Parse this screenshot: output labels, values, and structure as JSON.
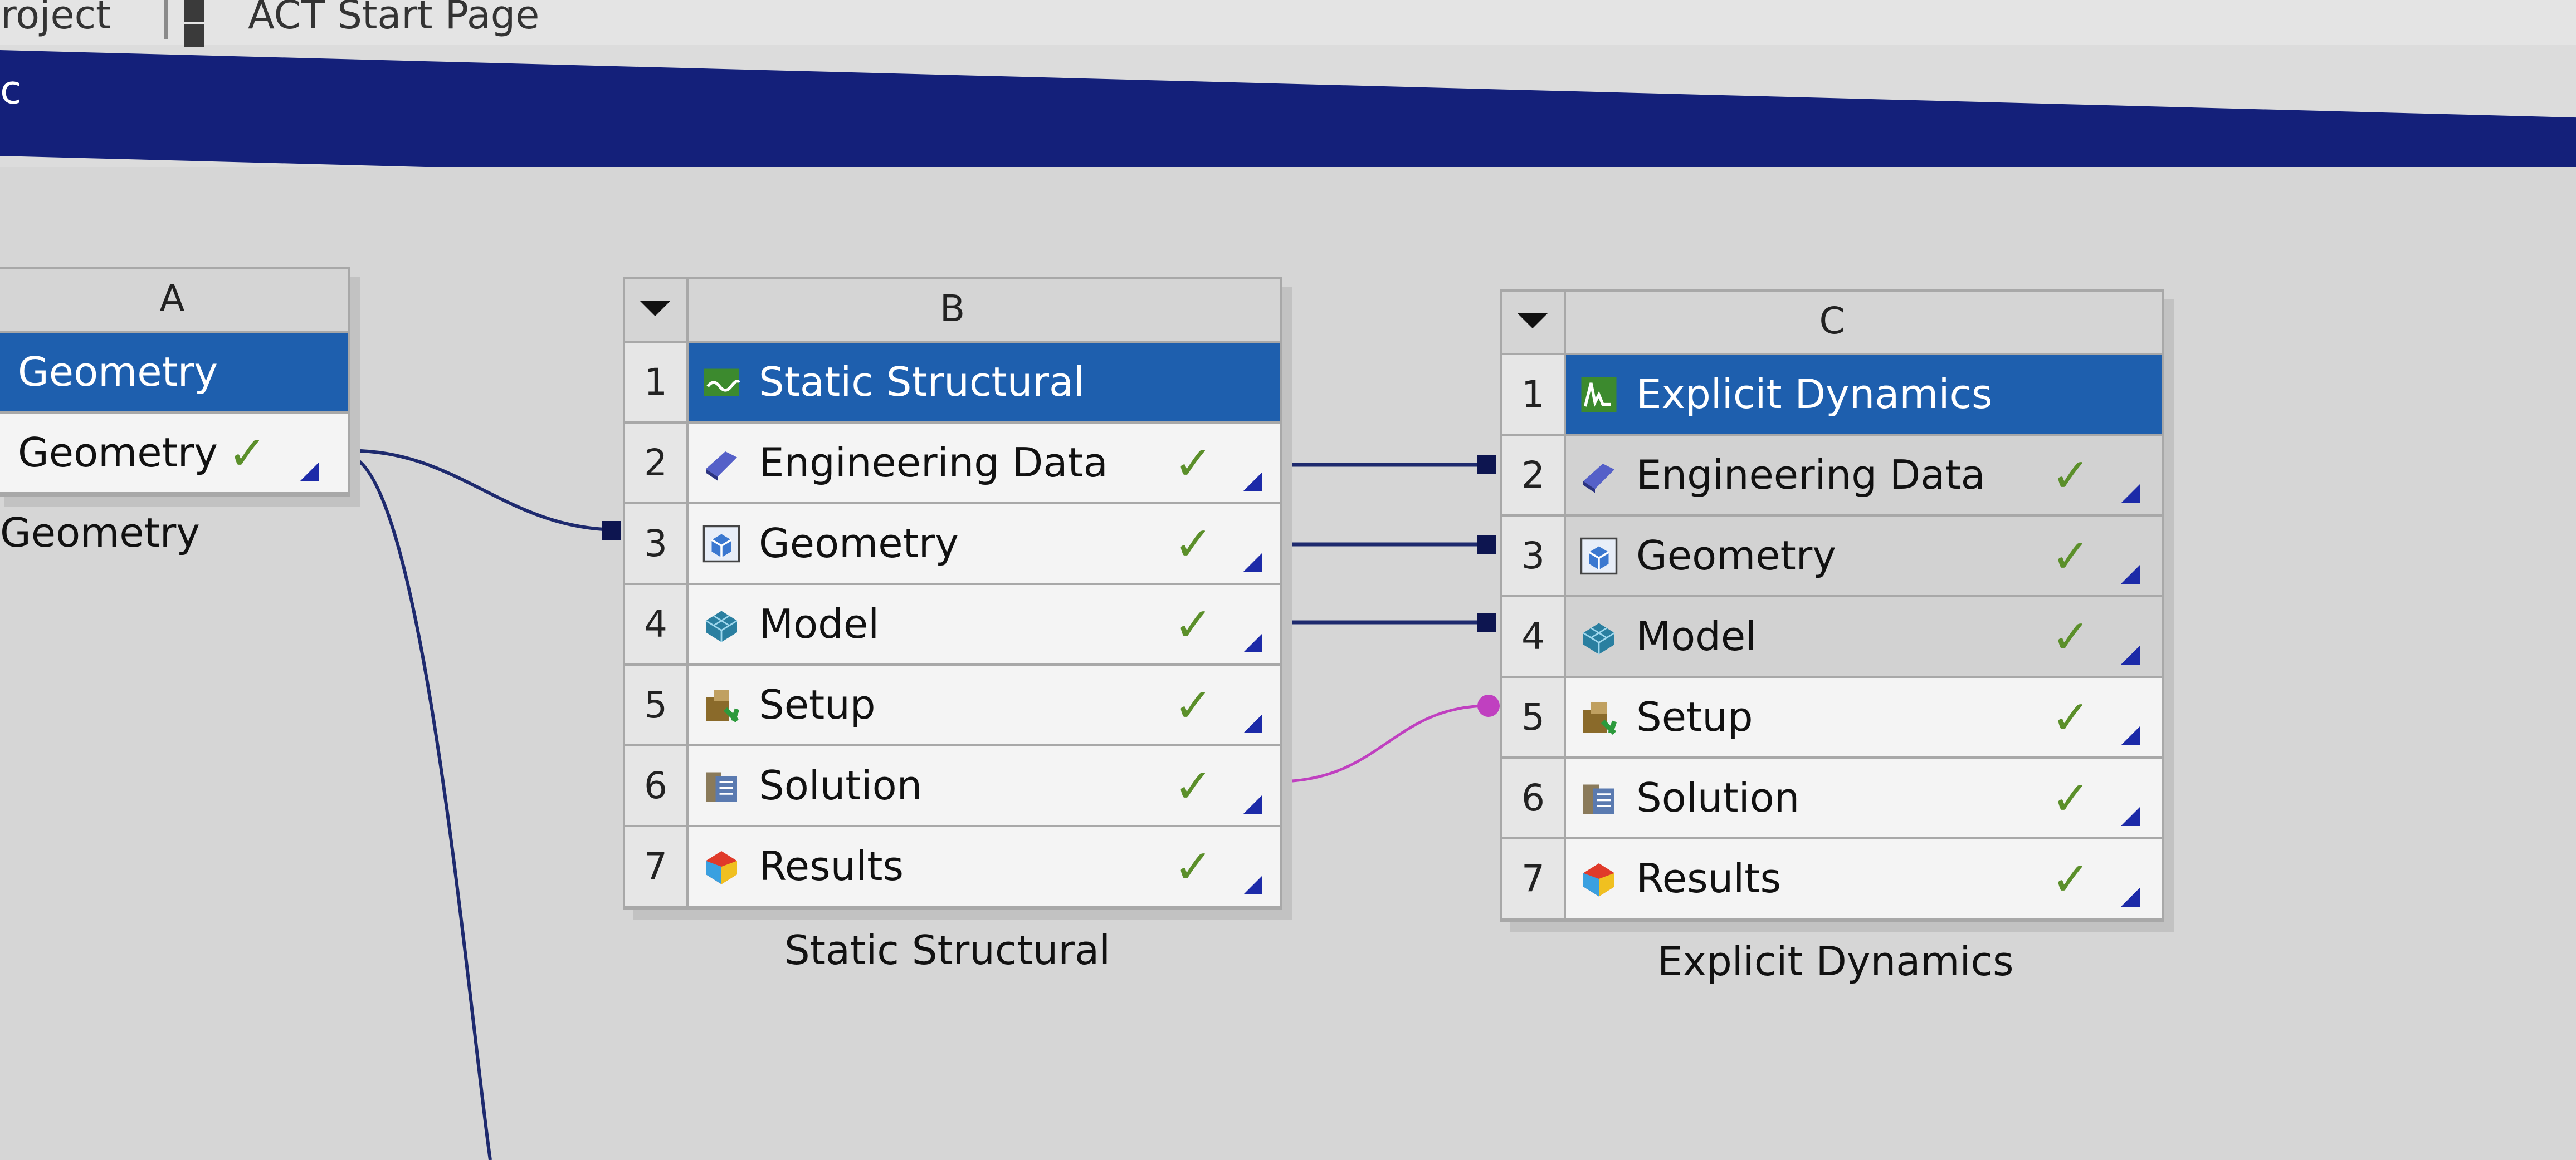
{
  "tabs": {
    "project": "Project",
    "act_start_page": "ACT Start Page"
  },
  "title_bar": {
    "text": "c"
  },
  "colors": {
    "title_row": "#1e5fae",
    "check": "#5b8f2a",
    "link": "#1e2a6e",
    "shared_link": "#c040c0"
  },
  "systems": [
    {
      "column": "A",
      "caption": "Geometry",
      "rows": [
        {
          "label": "Geometry",
          "icon": "geometry-system-icon",
          "title": true
        },
        {
          "label": "Geometry",
          "icon": "geometry-icon",
          "check": "✓"
        }
      ]
    },
    {
      "column": "B",
      "caption": "Static Structural",
      "rows": [
        {
          "num": "1",
          "label": "Static Structural",
          "icon": "static-structural-icon",
          "title": true
        },
        {
          "num": "2",
          "label": "Engineering Data",
          "icon": "engineering-data-icon",
          "check": "✓"
        },
        {
          "num": "3",
          "label": "Geometry",
          "icon": "geometry-icon",
          "check": "✓"
        },
        {
          "num": "4",
          "label": "Model",
          "icon": "model-icon",
          "check": "✓"
        },
        {
          "num": "5",
          "label": "Setup",
          "icon": "setup-icon",
          "check": "✓"
        },
        {
          "num": "6",
          "label": "Solution",
          "icon": "solution-icon",
          "check": "✓"
        },
        {
          "num": "7",
          "label": "Results",
          "icon": "results-icon",
          "check": "✓"
        }
      ]
    },
    {
      "column": "C",
      "caption": "Explicit Dynamics",
      "rows": [
        {
          "num": "1",
          "label": "Explicit Dynamics",
          "icon": "explicit-dynamics-icon",
          "title": true
        },
        {
          "num": "2",
          "label": "Engineering Data",
          "icon": "engineering-data-icon",
          "check": "✓"
        },
        {
          "num": "3",
          "label": "Geometry",
          "icon": "geometry-icon",
          "check": "✓"
        },
        {
          "num": "4",
          "label": "Model",
          "icon": "model-icon",
          "check": "✓"
        },
        {
          "num": "5",
          "label": "Setup",
          "icon": "setup-icon",
          "check": "✓"
        },
        {
          "num": "6",
          "label": "Solution",
          "icon": "solution-icon",
          "check": "✓"
        },
        {
          "num": "7",
          "label": "Results",
          "icon": "results-icon",
          "check": "✓"
        }
      ]
    }
  ]
}
